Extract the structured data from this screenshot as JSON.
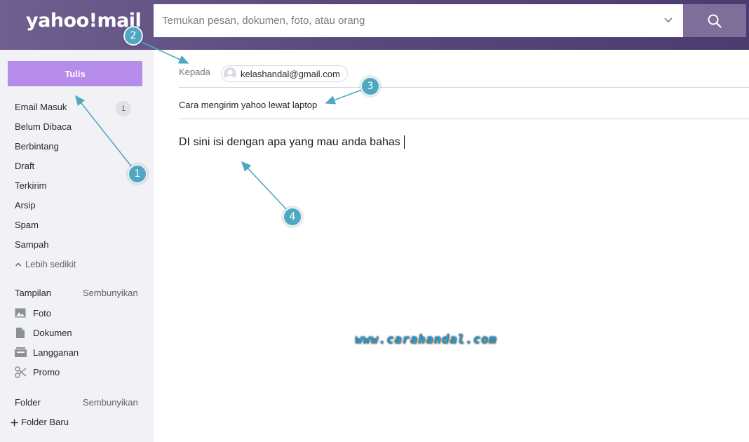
{
  "header": {
    "logo": "yahoo!mail",
    "search_placeholder": "Temukan pesan, dokumen, foto, atau orang"
  },
  "sidebar": {
    "compose_label": "Tulis",
    "folders": [
      {
        "label": "Email Masuk",
        "badge": "1"
      },
      {
        "label": "Belum Dibaca"
      },
      {
        "label": "Berbintang"
      },
      {
        "label": "Draft"
      },
      {
        "label": "Terkirim"
      },
      {
        "label": "Arsip"
      },
      {
        "label": "Spam"
      },
      {
        "label": "Sampah"
      }
    ],
    "less_label": "Lebih sedikit",
    "views": {
      "heading": "Tampilan",
      "hide_label": "Sembunyikan",
      "items": [
        {
          "label": "Foto",
          "icon": "image-icon"
        },
        {
          "label": "Dokumen",
          "icon": "document-icon"
        },
        {
          "label": "Langganan",
          "icon": "subscription-icon"
        },
        {
          "label": "Promo",
          "icon": "scissors-icon"
        }
      ]
    },
    "folder_section": {
      "heading": "Folder",
      "hide_label": "Sembunyikan",
      "new_folder_label": "Folder Baru"
    }
  },
  "compose": {
    "to_label": "Kepada",
    "recipient": "kelashandal@gmail.com",
    "subject": "Cara mengirim yahoo lewat laptop",
    "body": "DI sini isi dengan apa yang mau anda bahas"
  },
  "watermark": "www.carahandal.com",
  "callouts": [
    "1",
    "2",
    "3",
    "4"
  ],
  "colors": {
    "header": "#5a4a7c",
    "compose_button": "#b68ceb",
    "callout": "#4fa8c0"
  }
}
